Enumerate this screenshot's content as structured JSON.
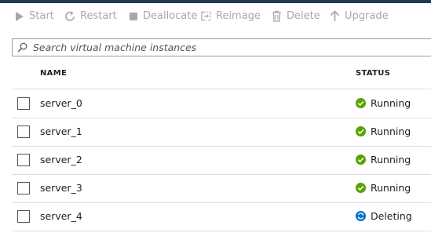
{
  "toolbar": {
    "start": "Start",
    "restart": "Restart",
    "deallocate": "Deallocate",
    "reimage": "Reimage",
    "delete": "Delete",
    "upgrade": "Upgrade"
  },
  "search": {
    "placeholder": "Search virtual machine instances"
  },
  "columns": {
    "name": "NAME",
    "status": "STATUS"
  },
  "rows": [
    {
      "name": "server_0",
      "status": "Running",
      "status_icon": "check-circle-icon"
    },
    {
      "name": "server_1",
      "status": "Running",
      "status_icon": "check-circle-icon"
    },
    {
      "name": "server_2",
      "status": "Running",
      "status_icon": "check-circle-icon"
    },
    {
      "name": "server_3",
      "status": "Running",
      "status_icon": "check-circle-icon"
    },
    {
      "name": "server_4",
      "status": "Deleting",
      "status_icon": "sync-icon"
    }
  ],
  "colors": {
    "running": "#57a300",
    "deleting": "#0072c6",
    "disabled_text": "#a8a8a8",
    "top_bar": "#1f3a57"
  }
}
